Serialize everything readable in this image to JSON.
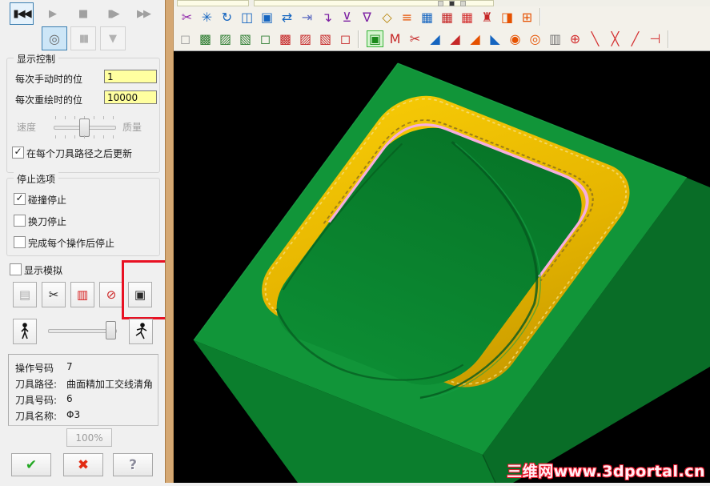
{
  "playback": {
    "rewind": "▮◀◀",
    "play": "▶",
    "stop": "■",
    "step": "▮▶",
    "ffwd": "▶▶",
    "loop": "◎",
    "pause": "▮▮",
    "funnel": "▼"
  },
  "display_control": {
    "title": "显示控制",
    "manual_step_label": "每次手动时的位",
    "manual_step_value": "1",
    "redraw_step_label": "每次重绘时的位",
    "redraw_step_value": "10000",
    "speed_label": "速度",
    "quality_label": "质量",
    "update_label": "在每个刀具路径之后更新",
    "update_glyph": "✓"
  },
  "stop_options": {
    "title": "停止选项",
    "items": [
      {
        "label": "碰撞停止",
        "glyph": "✓"
      },
      {
        "label": "换刀停止",
        "glyph": ""
      },
      {
        "label": "完成每个操作后停止",
        "glyph": ""
      }
    ]
  },
  "simulation": {
    "display_sim_label": "显示模拟",
    "display_sim_glyph": "",
    "buttons": [
      {
        "n": "results-book-icon",
        "g": "▤",
        "c": "#a8a8a8"
      },
      {
        "n": "section-cut-icon",
        "g": "✂",
        "c": "#2a2a2a"
      },
      {
        "n": "chart-bars-icon",
        "g": "▥",
        "c": "#d51616"
      },
      {
        "n": "zoom-disabled-icon",
        "g": "⊘",
        "c": "#cc2222"
      },
      {
        "n": "save-image-icon",
        "g": "▣",
        "c": "#2a2a2a"
      }
    ]
  },
  "operation_info": {
    "rows": [
      {
        "label": "操作号码",
        "value": "7"
      },
      {
        "label": "刀具路径:",
        "value": "曲面精加工交线清角"
      },
      {
        "label": "刀具号码:",
        "value": "6"
      },
      {
        "label": "刀具名称:",
        "value": "Φ3"
      }
    ]
  },
  "progress_label": "100%",
  "exit_buttons": {
    "ok": "✔",
    "cancel": "✖",
    "help": "?"
  },
  "toolbars": {
    "row1": [
      {
        "n": "trim-scissors-icon",
        "g": "✂",
        "c": "#8e24aa"
      },
      {
        "n": "pin-point-icon",
        "g": "✳",
        "c": "#1565c0"
      },
      {
        "n": "regen-rotate-icon",
        "g": "↻",
        "c": "#1565c0"
      },
      {
        "n": "copy-entity-icon",
        "g": "◫",
        "c": "#1565c0"
      },
      {
        "n": "move-entity-icon",
        "g": "▣",
        "c": "#1565c0"
      },
      {
        "n": "swap-axes-icon",
        "g": "⇄",
        "c": "#1565c0"
      },
      {
        "n": "export-arrow-icon",
        "g": "⇥",
        "c": "#5c6bc0"
      },
      {
        "n": "drop-arrow-icon",
        "g": "↴",
        "c": "#7b1fa2"
      },
      {
        "n": "press-depth-icon",
        "g": "⊻",
        "c": "#7b1fa2"
      },
      {
        "n": "filter-plane-icon",
        "g": "∇",
        "c": "#7b1fa2"
      },
      {
        "n": "edit-diamond-icon",
        "g": "◇",
        "c": "#b8860b"
      },
      {
        "n": "list-lines-icon",
        "g": "≡",
        "c": "#e65100"
      },
      {
        "n": "grid-blue-icon",
        "g": "▦",
        "c": "#1565c0"
      },
      {
        "n": "grid-red-icon",
        "g": "▦",
        "c": "#c62828"
      },
      {
        "n": "grid-mixed-icon",
        "g": "▦",
        "c": "#d32f2f"
      },
      {
        "n": "tower-chart-icon",
        "g": "♜",
        "c": "#c62828"
      },
      {
        "n": "table-export-icon",
        "g": "◨",
        "c": "#e65100"
      },
      {
        "n": "grid-frame-icon",
        "g": "⊞",
        "c": "#e65100"
      }
    ],
    "row2a": [
      {
        "n": "cube-clip-icon",
        "g": "◻",
        "c": "#9e9e9e"
      },
      {
        "n": "stock-cube-solid-icon",
        "g": "▩",
        "c": "#2e7d32"
      },
      {
        "n": "stock-cube-shade-icon",
        "g": "▨",
        "c": "#2e7d32"
      },
      {
        "n": "stock-cube-open-icon",
        "g": "▧",
        "c": "#2e7d32"
      },
      {
        "n": "stock-cube-wire-icon",
        "g": "◻",
        "c": "#2e7d32"
      },
      {
        "n": "tool-cube-solid-icon",
        "g": "▩",
        "c": "#c62828"
      },
      {
        "n": "tool-cube-shade-icon",
        "g": "▨",
        "c": "#c62828"
      },
      {
        "n": "tool-cube-open-icon",
        "g": "▧",
        "c": "#c62828"
      },
      {
        "n": "tool-cube-wire-icon",
        "g": "◻",
        "c": "#c62828"
      }
    ],
    "row2b": [
      {
        "n": "stock-display-icon",
        "g": "▣",
        "c": "#1b8a1b",
        "sel": true
      },
      {
        "n": "machine-m-icon",
        "g": "M",
        "c": "#c62828"
      },
      {
        "n": "verify-cut-icon",
        "g": "✂",
        "c": "#c62828"
      },
      {
        "n": "flowline-a-icon",
        "g": "◢",
        "c": "#1565c0"
      },
      {
        "n": "flowline-b-icon",
        "g": "◢",
        "c": "#c62828"
      },
      {
        "n": "flowline-c-icon",
        "g": "◢",
        "c": "#e65100"
      },
      {
        "n": "flowline-d-icon",
        "g": "◣",
        "c": "#1565c0"
      },
      {
        "n": "ball-path-a-icon",
        "g": "◉",
        "c": "#e65100"
      },
      {
        "n": "ball-path-b-icon",
        "g": "◎",
        "c": "#e65100"
      },
      {
        "n": "drill-bit-icon",
        "g": "▥",
        "c": "#757575"
      },
      {
        "n": "circle-center-icon",
        "g": "⊕",
        "c": "#d32f2f"
      },
      {
        "n": "point-line-a-icon",
        "g": "╲",
        "c": "#d32f2f"
      },
      {
        "n": "point-cross-icon",
        "g": "╳",
        "c": "#d32f2f"
      },
      {
        "n": "point-line-b-icon",
        "g": "╱",
        "c": "#d32f2f"
      },
      {
        "n": "point-end-icon",
        "g": "⊣",
        "c": "#d32f2f"
      }
    ]
  },
  "viewport": {
    "watermark": "三维网www.3dportal.cn",
    "colors": {
      "background": "#000000",
      "block_top": "#119539",
      "block_left_face": "#0b7e2d",
      "block_right_face": "#096d27",
      "pocket_wall_yellow": "#f0c000",
      "pocket_wall_shadow": "#c79a00",
      "dome_green": "#0a8230",
      "boundary_pink": "#f6aedd",
      "annotation_red": "#e81123"
    }
  }
}
